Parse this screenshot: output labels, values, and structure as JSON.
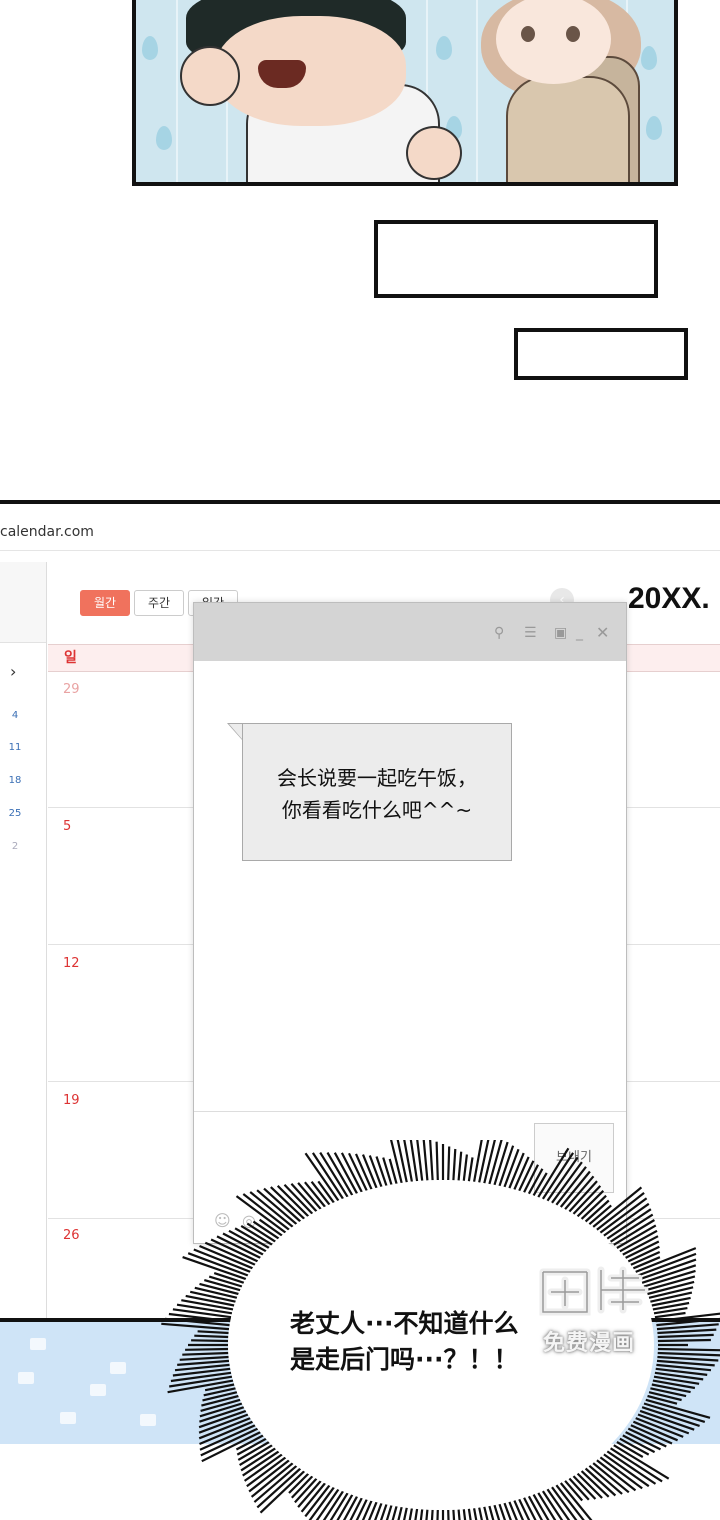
{
  "calendar_window": {
    "url": "calendar.com",
    "views": [
      "월간",
      "주간",
      "일간"
    ],
    "year": "20XX.",
    "day_header": "일",
    "week_dates": [
      "29",
      "5",
      "12",
      "19",
      "26"
    ],
    "mini_dates": [
      "4",
      "11",
      "18",
      "25",
      "2"
    ]
  },
  "messenger": {
    "message_lines": [
      "会长说要一起吃午饭，",
      "你看看吃什么吧^^~"
    ],
    "send_label": "보내기"
  },
  "speech": {
    "lines": [
      "老丈人···不知道什么",
      "是走后门吗···？！！"
    ]
  },
  "watermark": {
    "text": "免费漫画"
  }
}
